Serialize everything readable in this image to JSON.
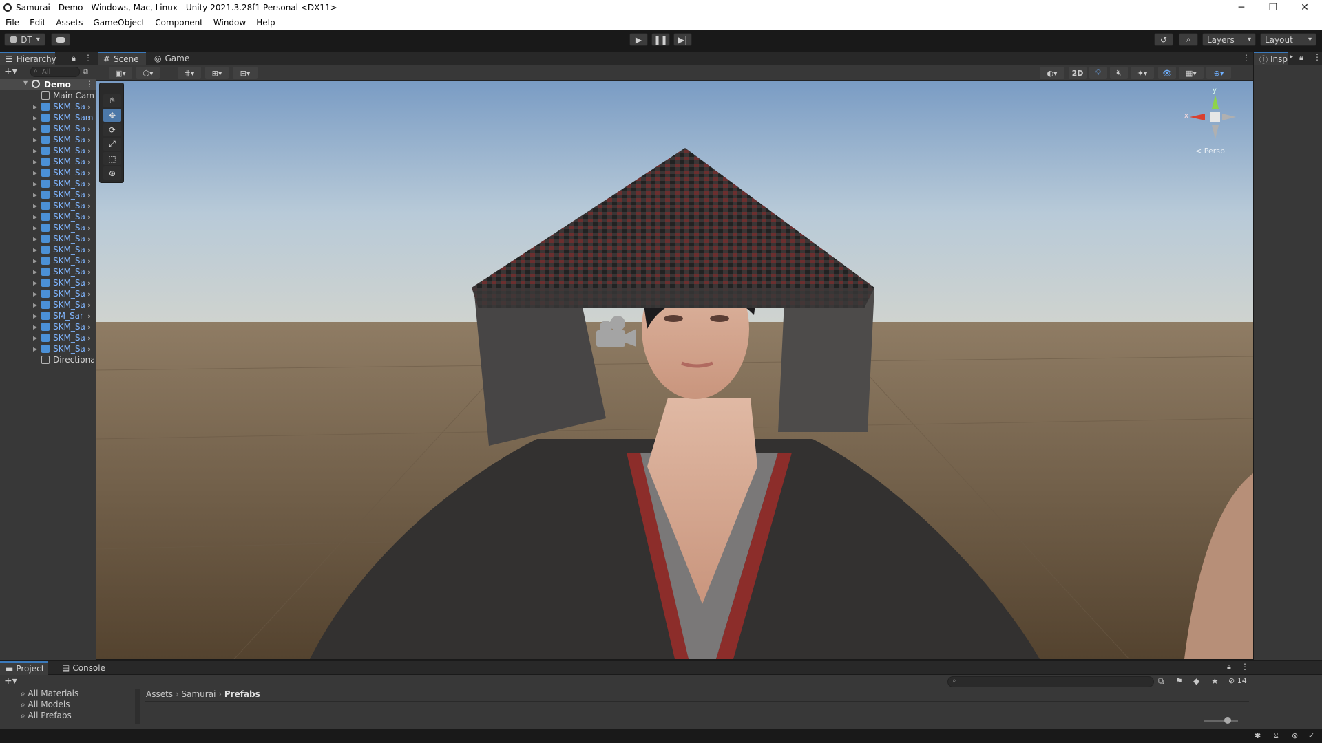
{
  "window": {
    "title": "Samurai - Demo - Windows, Mac, Linux - Unity 2021.3.28f1 Personal <DX11>",
    "controls": [
      "─",
      "❐",
      "✕"
    ]
  },
  "menu": [
    "File",
    "Edit",
    "Assets",
    "GameObject",
    "Component",
    "Window",
    "Help"
  ],
  "toolbar": {
    "account_label": "DT",
    "layers_label": "Layers",
    "layout_label": "Layout"
  },
  "hierarchy": {
    "tab_label": "Hierarchy",
    "search_placeholder": "All",
    "scene_name": "Demo",
    "items": [
      {
        "name": "Main Came",
        "type": "object"
      },
      {
        "name": "SKM_Sa",
        "type": "prefab"
      },
      {
        "name": "SKM_Samu",
        "type": "prefab"
      },
      {
        "name": "SKM_Sa",
        "type": "prefab"
      },
      {
        "name": "SKM_Sa",
        "type": "prefab"
      },
      {
        "name": "SKM_Sa",
        "type": "prefab"
      },
      {
        "name": "SKM_Sa",
        "type": "prefab"
      },
      {
        "name": "SKM_Sa",
        "type": "prefab"
      },
      {
        "name": "SKM_Sa",
        "type": "prefab"
      },
      {
        "name": "SKM_Sa",
        "type": "prefab"
      },
      {
        "name": "SKM_Sa",
        "type": "prefab"
      },
      {
        "name": "SKM_Sa",
        "type": "prefab"
      },
      {
        "name": "SKM_Sa",
        "type": "prefab"
      },
      {
        "name": "SKM_Sa",
        "type": "prefab"
      },
      {
        "name": "SKM_Sa",
        "type": "prefab"
      },
      {
        "name": "SKM_Sa",
        "type": "prefab"
      },
      {
        "name": "SKM_Sa",
        "type": "prefab"
      },
      {
        "name": "SKM_Sa",
        "type": "prefab"
      },
      {
        "name": "SKM_Sa",
        "type": "prefab"
      },
      {
        "name": "SKM_Sa",
        "type": "prefab"
      },
      {
        "name": "SM_Sar",
        "type": "prefab"
      },
      {
        "name": "SKM_Sa",
        "type": "prefab"
      },
      {
        "name": "SKM_Sa",
        "type": "prefab"
      },
      {
        "name": "SKM_Sa",
        "type": "prefab"
      },
      {
        "name": "Directiona",
        "type": "object"
      }
    ]
  },
  "scene": {
    "tabs": [
      "Scene",
      "Game"
    ],
    "active_tab": "Scene",
    "mode_2d_label": "2D",
    "gizmo_label": "Persp",
    "gizmo_axis_y": "y",
    "gizmo_axis_x": "x"
  },
  "inspector": {
    "tab_label": "Insp"
  },
  "project": {
    "tabs": [
      "Project",
      "Console"
    ],
    "favorites": [
      "All Materials",
      "All Models",
      "All Prefabs"
    ],
    "breadcrumb": [
      "Assets",
      "Samurai",
      "Prefabs"
    ],
    "hidden_count": "14"
  },
  "colors": {
    "accent": "#3a79bb",
    "prefab_blue": "#80b6ff"
  }
}
